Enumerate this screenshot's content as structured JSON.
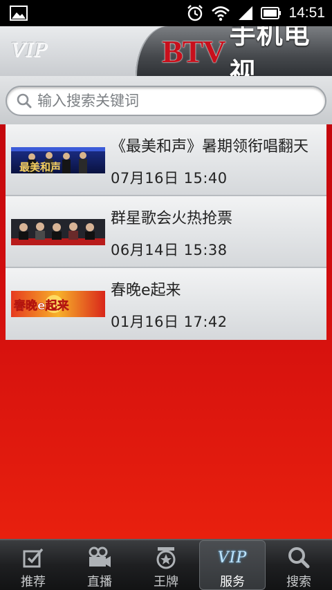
{
  "status_bar": {
    "time": "14:51",
    "icons": [
      "gallery-icon",
      "alarm-icon",
      "wifi-icon",
      "signal-icon",
      "battery-icon"
    ]
  },
  "header": {
    "vip_tag": "VIP",
    "brand_latin": "BTV",
    "brand_cn": "手机电视",
    "brand_color": "#c8101c"
  },
  "search": {
    "placeholder": "输入搜索关键词",
    "icon": "search-icon"
  },
  "list": {
    "items": [
      {
        "title": "《最美和声》暑期领衔唱翻天",
        "date": "07月16日  15:40",
        "thumb": "zuimeihesheng-banner",
        "thumb_text": "最美和声"
      },
      {
        "title": "群星歌会火热抢票",
        "date": "06月14日  15:38",
        "thumb": "qunxing-gehui-banner",
        "thumb_text": ""
      },
      {
        "title": "春晚e起来",
        "date": "01月16日  17:42",
        "thumb": "chunwan-e-qilai-banner",
        "thumb_text": "春晚e起来"
      }
    ]
  },
  "tab_bar": {
    "tabs": [
      {
        "label": "推荐",
        "icon": "checkbox-edit-icon",
        "active": false
      },
      {
        "label": "直播",
        "icon": "video-camera-icon",
        "active": false
      },
      {
        "label": "王牌",
        "icon": "badge-icon",
        "active": false
      },
      {
        "label": "服务",
        "icon": "vip-icon",
        "active": true,
        "icon_text": "VIP"
      },
      {
        "label": "搜索",
        "icon": "search-icon",
        "active": false
      }
    ]
  },
  "colors": {
    "content_background": "#d20e0e",
    "tab_bar_background": "#1e1f21"
  }
}
